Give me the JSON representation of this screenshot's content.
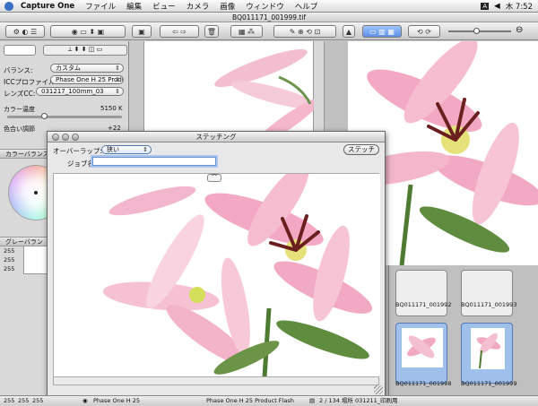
{
  "menubar": {
    "app": "Capture One",
    "items": [
      "ファイル",
      "編集",
      "ビュー",
      "カメラ",
      "画像",
      "ウィンドウ",
      "ヘルプ"
    ],
    "input_badge": "A",
    "clock": "木 7:52"
  },
  "window": {
    "title": "BQ011171_001999.tif"
  },
  "left_panel": {
    "balance_label": "バランス:",
    "balance_value": "カスタム",
    "icc_label": "ICCプロファイル:",
    "icc_value": "Phase One H 25 Product",
    "lens_label": "レンズCC:",
    "lens_value": "031217_100mm_03",
    "color_temp_label": "カラー温度",
    "color_temp_value": "5150 K",
    "tint_label": "色合い調節",
    "tint_value": "+22",
    "color_balance_label": "カラーバランス補",
    "grey_label": "グレーバラン",
    "grey_values": [
      "255",
      "255",
      "255"
    ]
  },
  "dialog": {
    "title": "ステッチング",
    "overlap_label": "オーバーラップ:",
    "overlap_value": "狭い",
    "stitch_button": "ステッチ",
    "job_label": "ジョブ名:",
    "job_value": ""
  },
  "thumbnails": [
    {
      "label": "BQ011171_001992",
      "selected": false
    },
    {
      "label": "BQ011171_001993",
      "selected": false
    },
    {
      "label": "BQ011171_001998",
      "selected": true
    },
    {
      "label": "BQ011171_001999",
      "selected": true
    }
  ],
  "status": {
    "values": [
      "255",
      "255",
      "255"
    ],
    "camera": "Phase One H 25",
    "icc": "Phase One H 25 Product Flash",
    "count": "2 / 134 場所 031211_印刷用"
  },
  "colors": {
    "accent": "#3b6fc6",
    "selection": "#9fc0ea"
  }
}
